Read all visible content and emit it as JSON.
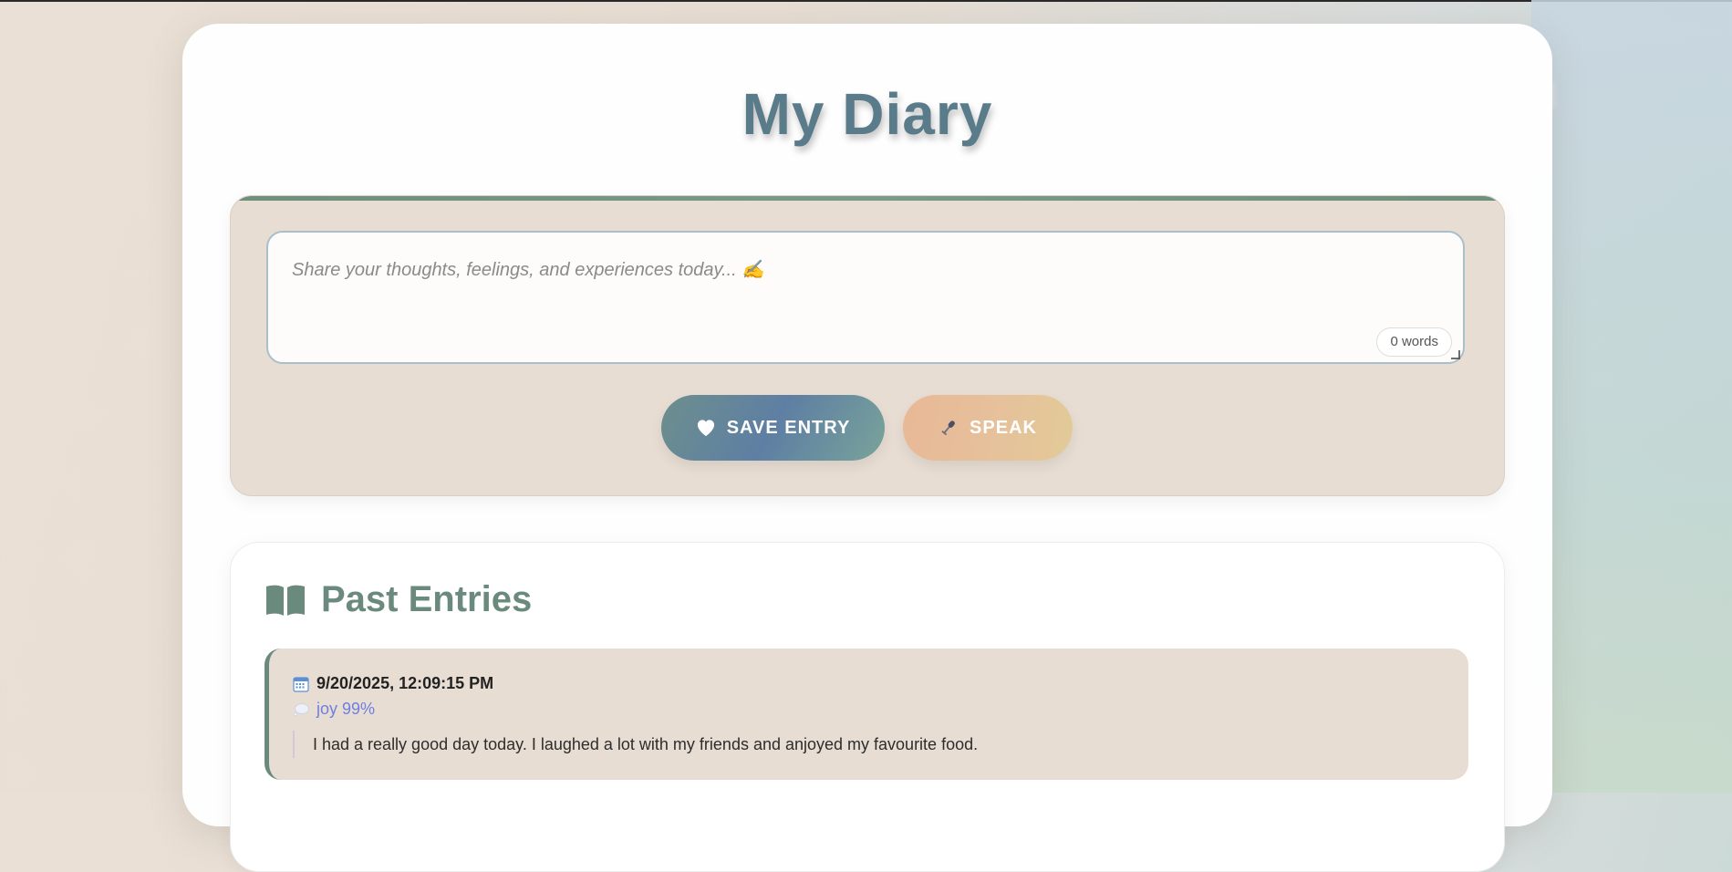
{
  "app": {
    "title": "My Diary"
  },
  "composer": {
    "placeholder": "Share your thoughts, feelings, and experiences today... ✍️",
    "value": "",
    "word_count": "0 words",
    "buttons": {
      "save_label": "SAVE ENTRY",
      "save_icon": "heart-icon",
      "speak_label": "SPEAK",
      "speak_icon": "microphone-icon"
    }
  },
  "past_entries": {
    "title": "Past Entries",
    "icon": "open-book-icon",
    "entries": [
      {
        "date": "9/20/2025, 12:09:15 PM",
        "date_icon": "calendar-icon",
        "emotion": "joy 99%",
        "emotion_icon": "thought-bubble-icon",
        "text": "I had a really good day today. I laughed a lot with my friends and anjoyed my favourite food."
      }
    ]
  },
  "colors": {
    "title": "#5a7b8a",
    "accent_green": "#6b8a7e",
    "emotion_text": "#6e7fe0",
    "composer_bg": "#e7ddd3",
    "save_gradient": [
      "#6d8f8d",
      "#5e7fa3",
      "#79a39a"
    ],
    "speak_gradient": [
      "#e8b896",
      "#e2ca98"
    ]
  }
}
